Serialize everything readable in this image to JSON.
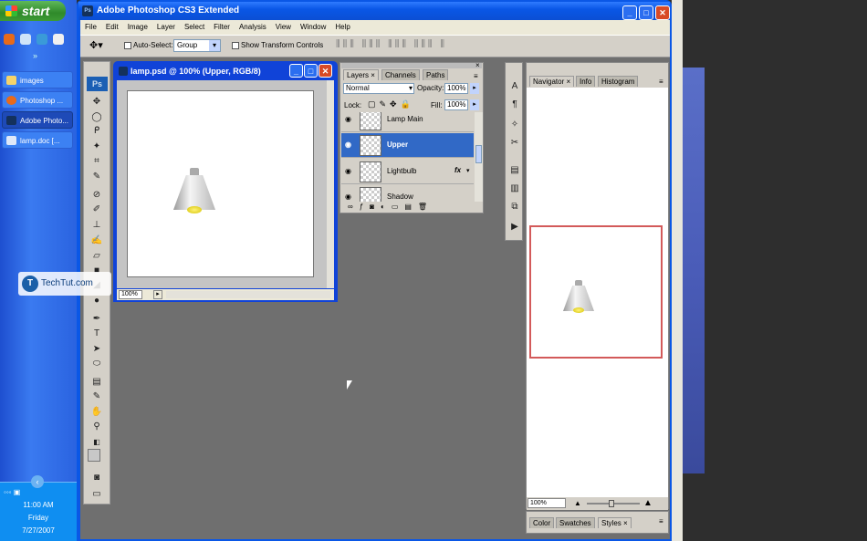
{
  "taskbar": {
    "start_label": "start",
    "buttons": [
      {
        "label": "images",
        "active": false
      },
      {
        "label": "Photoshop ...",
        "active": false
      },
      {
        "label": "Adobe Photo...",
        "active": true
      },
      {
        "label": "lamp.doc [...",
        "active": false
      }
    ],
    "clock": {
      "time": "11:00 AM",
      "day": "Friday",
      "date": "7/27/2007"
    }
  },
  "app": {
    "title": "Adobe Photoshop CS3 Extended",
    "menu": [
      "File",
      "Edit",
      "Image",
      "Layer",
      "Select",
      "Filter",
      "Analysis",
      "View",
      "Window",
      "Help"
    ],
    "options": {
      "auto_select_label": "Auto-Select:",
      "auto_select_value": "Group",
      "show_transform_label": "Show Transform Controls"
    },
    "tools_logo": "Ps"
  },
  "document": {
    "title": "lamp.psd @ 100% (Upper, RGB/8)",
    "zoom": "100%"
  },
  "layers_panel": {
    "tabs": [
      "Layers",
      "Channels",
      "Paths"
    ],
    "blend_mode": "Normal",
    "opacity_label": "Opacity:",
    "opacity_value": "100%",
    "lock_label": "Lock:",
    "fill_label": "Fill:",
    "fill_value": "100%",
    "layers": [
      {
        "name": "Lamp Main",
        "selected": false
      },
      {
        "name": "Upper",
        "selected": true
      },
      {
        "name": "Lightbulb",
        "selected": false,
        "fx": "fx"
      },
      {
        "name": "Shadow",
        "selected": false
      }
    ]
  },
  "navigator_panel": {
    "tabs": [
      "Navigator",
      "Info",
      "Histogram"
    ],
    "zoom": "100%"
  },
  "color_panel": {
    "tabs": [
      "Color",
      "Swatches",
      "Styles"
    ]
  },
  "watermark": {
    "text": "TechTut.com"
  }
}
